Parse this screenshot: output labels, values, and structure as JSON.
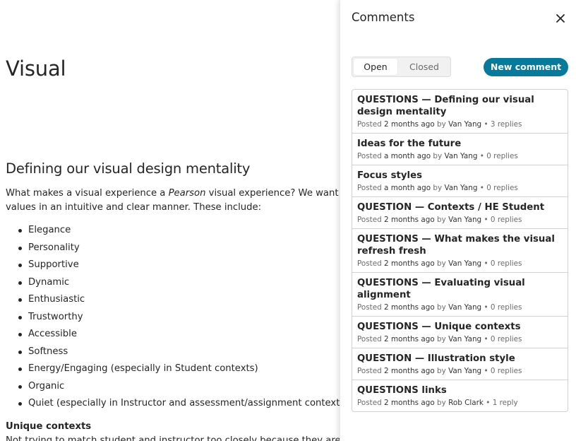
{
  "document": {
    "title": "Visual",
    "section_heading": "Defining our visual design mentality",
    "intro": {
      "line1_before": "What makes a visual experience a ",
      "line1_emphasis": "Pearson",
      "line1_after": " visual experience? We want our pag",
      "line2": "values in an intuitive and clear manner. These include:"
    },
    "values": [
      "Elegance",
      "Personality",
      "Supportive",
      "Dynamic",
      "Enthusiastic",
      "Trustworthy",
      "Accessible",
      "Softness",
      "Energy/Engaging (especially in Student contexts)",
      "Organic",
      "Quiet (especially in Instructor and assessment/assignment contexts)"
    ],
    "subheading": "Unique contexts",
    "cut_off_line": "Not trying to match student and instructor too closely because they are differ"
  },
  "comments_panel": {
    "title": "Comments",
    "close_icon": "close-icon",
    "filter": {
      "options": [
        "Open",
        "Closed"
      ],
      "selected": "Open"
    },
    "new_comment_label": "New comment",
    "accent_color": "#047a9c",
    "meta_words": {
      "posted": "Posted",
      "by": "by",
      "separator": "•"
    },
    "comments": [
      {
        "title": "QUESTIONS — Defining our visual design mentality",
        "when": "2 months ago",
        "author": "Van Yang",
        "replies": "3 replies"
      },
      {
        "title": "Ideas for the future",
        "when": "a month ago",
        "author": "Van Yang",
        "replies": "0 replies"
      },
      {
        "title": "Focus styles",
        "when": "a month ago",
        "author": "Van Yang",
        "replies": "0 replies"
      },
      {
        "title": "QUESTION — Contexts / HE Student",
        "when": "2 months ago",
        "author": "Van Yang",
        "replies": "0 replies"
      },
      {
        "title": "QUESTIONS — What makes the visual refresh fresh",
        "when": "2 months ago",
        "author": "Van Yang",
        "replies": "0 replies"
      },
      {
        "title": "QUESTIONS — Evaluating visual alignment",
        "when": "2 months ago",
        "author": "Van Yang",
        "replies": "0 replies"
      },
      {
        "title": "QUESTIONS — Unique contexts",
        "when": "2 months ago",
        "author": "Van Yang",
        "replies": "0 replies"
      },
      {
        "title": "QUESTION — Illustration style",
        "when": "2 months ago",
        "author": "Van Yang",
        "replies": "0 replies"
      },
      {
        "title": "QUESTIONS links",
        "when": "2 months ago",
        "author": "Rob Clark",
        "replies": "1 reply"
      }
    ]
  }
}
